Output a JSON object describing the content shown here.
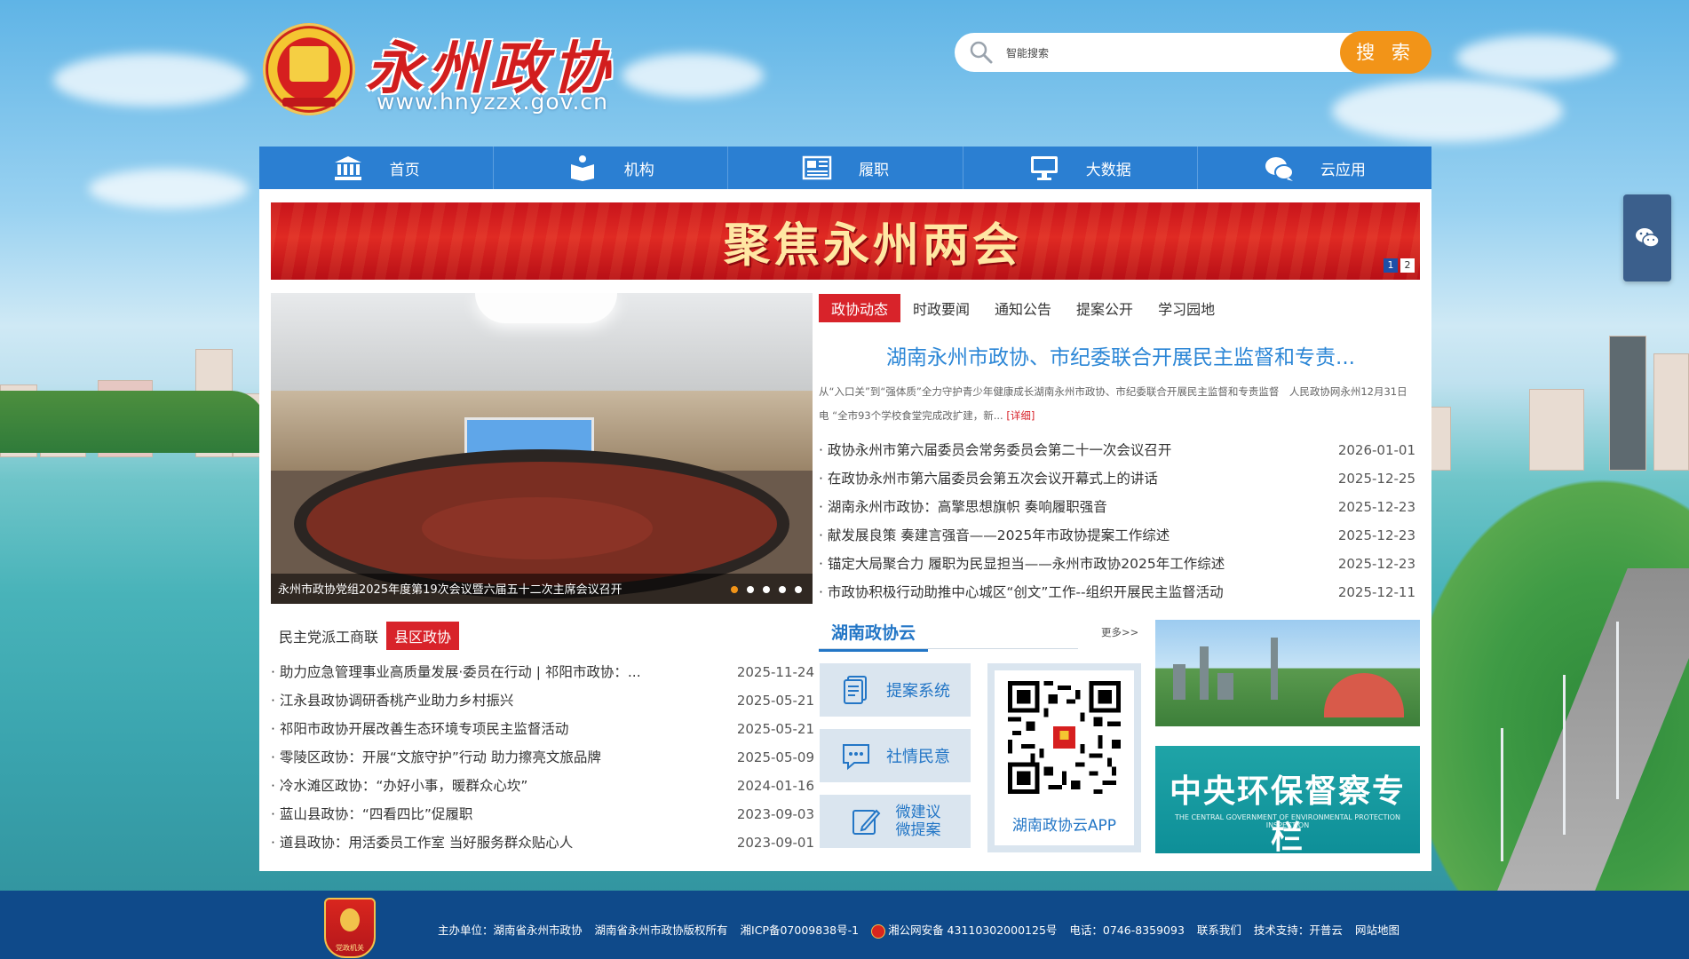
{
  "header": {
    "logo_text": "永州政协",
    "site_url": "www.hnyzzx.gov.cn",
    "search": {
      "placeholder": "智能搜索",
      "button_label": "搜 索"
    }
  },
  "nav": {
    "items": [
      {
        "label": "首页",
        "icon": "institution-icon"
      },
      {
        "label": "机构",
        "icon": "book-person-icon"
      },
      {
        "label": "履职",
        "icon": "newspaper-icon"
      },
      {
        "label": "大数据",
        "icon": "monitor-icon"
      },
      {
        "label": "云应用",
        "icon": "cloud-chat-icon"
      }
    ]
  },
  "banner": {
    "title": "聚焦永州两会",
    "pager": [
      "1",
      "2"
    ],
    "active_page": "1"
  },
  "slider": {
    "caption": "永州市政协党组2025年度第19次会议暨六届五十二次主席会议召开",
    "dot_count": 5,
    "active_dot": 1
  },
  "news": {
    "tabs": [
      "政协动态",
      "时政要闻",
      "通知公告",
      "提案公开",
      "学习园地"
    ],
    "active_tab": "政协动态",
    "headline": "湖南永州市政协、市纪委联合开展民主监督和专责...",
    "summary": "从“入口关”到“强体质”全力守护青少年健康成长湖南永州市政协、市纪委联合开展民主监督和专责监督　人民政协网永州12月31日电 “全市93个学校食堂完成改扩建，新...",
    "summary_more": "[详细]",
    "items": [
      {
        "title": "政协永州市第六届委员会常务委员会第二十一次会议召开",
        "date": "2026-01-01"
      },
      {
        "title": "在政协永州市第六届委员会第五次会议开幕式上的讲话",
        "date": "2025-12-25"
      },
      {
        "title": "湖南永州市政协：高擎思想旗帜 奏响履职强音",
        "date": "2025-12-23"
      },
      {
        "title": "献发展良策 奏建言强音——2025年市政协提案工作综述",
        "date": "2025-12-23"
      },
      {
        "title": "锚定大局聚合力 履职为民显担当——永州市政协2025年工作综述",
        "date": "2025-12-23"
      },
      {
        "title": "市政协积极行动助推中心城区“创文”工作--组织开展民主监督活动",
        "date": "2025-12-11"
      }
    ]
  },
  "county": {
    "tabs": [
      "民主党派工商联",
      "县区政协"
    ],
    "active_tab": "县区政协",
    "items": [
      {
        "title": "助力应急管理事业高质量发展·委员在行动 | 祁阳市政协：...",
        "date": "2025-11-24"
      },
      {
        "title": "江永县政协调研香桃产业助力乡村振兴",
        "date": "2025-05-21"
      },
      {
        "title": "祁阳市政协开展改善生态环境专项民主监督活动",
        "date": "2025-05-21"
      },
      {
        "title": "零陵区政协：开展“文旅守护”行动 助力擦亮文旅品牌",
        "date": "2025-05-09"
      },
      {
        "title": "冷水滩区政协：“办好小事，暖群众心坎”",
        "date": "2024-01-16"
      },
      {
        "title": "蓝山县政协：“四看四比”促履职",
        "date": "2023-09-03"
      },
      {
        "title": "道县政协：用活委员工作室 当好服务群众贴心人",
        "date": "2023-09-01"
      }
    ]
  },
  "cloud": {
    "title": "湖南政协云",
    "more": "更多>>",
    "apps": [
      {
        "label": "提案系统",
        "icon": "document-icon"
      },
      {
        "label": "社情民意",
        "icon": "chat-bubble-icon"
      },
      {
        "label_1": "微建议",
        "label_2": "微提案",
        "icon": "edit-icon"
      }
    ],
    "qr_label": "湖南政协云APP"
  },
  "promo": {
    "env_title": "中央环保督察专栏",
    "env_subtitle": "THE CENTRAL GOVERNMENT OF ENVIRONMENTAL PROTECTION INSPECTION"
  },
  "footer": {
    "host": "主办单位：湖南省永州市政协",
    "copyright": "湖南省永州市政协版权所有",
    "icp": "湘ICP备07009838号-1",
    "police": "湘公网安备 43110302000125号",
    "phone": "电话：0746-8359093",
    "contact": "联系我们",
    "support": "技术支持：开普云",
    "sitemap": "网站地图",
    "emblem_text": "党政机关"
  },
  "colors": {
    "nav_blue": "#2b7fd2",
    "accent_red": "#d8232a",
    "search_orange": "#f29418",
    "footer_blue": "#0f4a8a",
    "link_blue": "#2b86d6"
  }
}
